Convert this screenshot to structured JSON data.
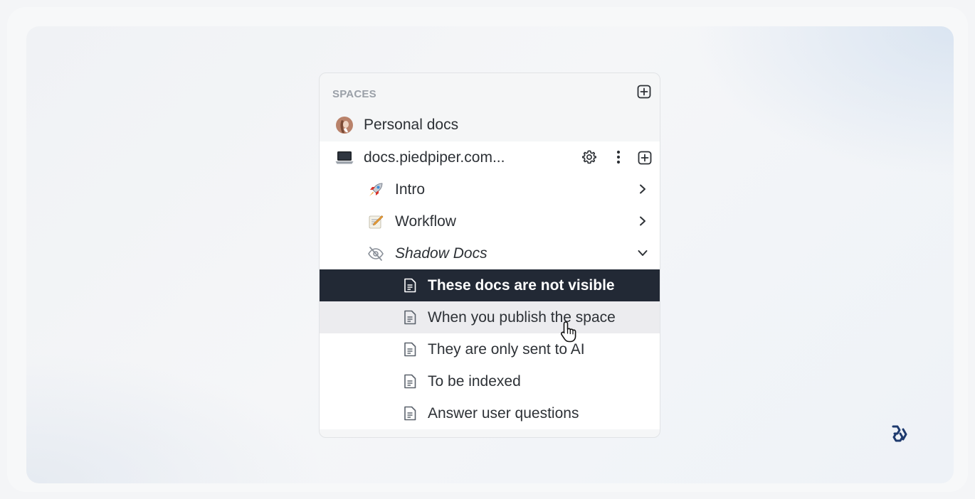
{
  "sidebar": {
    "section_title": "SPACES",
    "personal": {
      "label": "Personal docs"
    },
    "space": {
      "label": "docs.piedpiper.com..."
    },
    "items": [
      {
        "label": "Intro",
        "icon": "rocket-icon",
        "expanded": false
      },
      {
        "label": "Workflow",
        "icon": "memo-icon",
        "expanded": false
      },
      {
        "label": "Shadow Docs",
        "icon": "eye-slash-icon",
        "expanded": true
      }
    ],
    "children": [
      {
        "label": "These docs are not visible",
        "state": "active"
      },
      {
        "label": "When you publish the space",
        "state": "hover"
      },
      {
        "label": "They are only sent to AI",
        "state": "normal"
      },
      {
        "label": "To be indexed",
        "state": "normal"
      },
      {
        "label": "Answer user questions",
        "state": "normal"
      }
    ]
  },
  "colors": {
    "active_bg": "#222935",
    "hover_bg": "#ececef",
    "text": "#2d3136",
    "muted": "#9aa0a8",
    "brand": "#1e3a6e"
  }
}
